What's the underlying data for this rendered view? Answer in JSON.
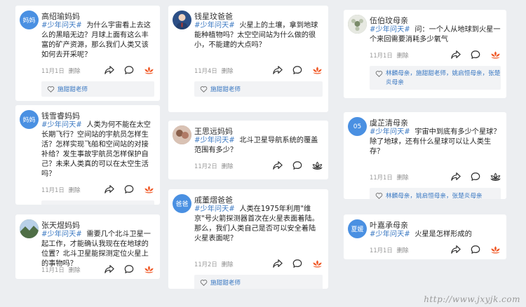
{
  "posts": [
    {
      "name": "高绍瑜妈妈",
      "avatar_text": "妈妈",
      "avatar_color": "#4a90e2",
      "tag": "#少年问天#",
      "text": "为什么宇宙看上去这么的黑暗无边？月球上面有这么丰富的矿产资源，那么我们人类又该如何去开采呢？",
      "date": "11月1日",
      "delete": "删除",
      "likes": "施甜甜老师",
      "liked": true
    },
    {
      "name": "钱雪睿妈妈",
      "avatar_text": "妈妈",
      "avatar_color": "#4a90e2",
      "tag": "#少年问天#",
      "text": "人类为何不能在太空长期飞行？空间站的宇航员怎样生活？怎样实现飞船和空间站的对接补给？发生事故宇航员怎样保护自己？未来人类真的可以在太空生活吗？",
      "date": "11月1日",
      "delete": "删除",
      "likes": "施甜甜老师",
      "liked": true
    },
    {
      "name": "张天煜妈妈",
      "avatar_text": "",
      "avatar_color": "#5c7a52",
      "tag": "#少年问天#",
      "text": "需要几个北斗卫星一起工作，才能确认我现在在地球的位置？北斗卫星能探测定位火星上的事物吗？",
      "date": "11月1日",
      "delete": "删除",
      "likes": "",
      "liked": true
    },
    {
      "name": "钱星玟爸爸",
      "avatar_text": "",
      "avatar_color": "#2c4f86",
      "tag": "#少年问天#",
      "text": "火星上的土壤，拿到地球能种植物吗？太空空间站为什么做的很小，不能建的大点吗？",
      "date": "11月4日",
      "delete": "删除",
      "likes": "施甜甜老师",
      "liked": true
    },
    {
      "name": "王思远妈妈",
      "avatar_text": "",
      "avatar_color": "#a08474",
      "tag": "#少年问天#",
      "text": "北斗卫星导航系统的覆盖范围有多少？",
      "date": "11月2日",
      "delete": "删除",
      "likes": "",
      "liked": false
    },
    {
      "name": "戚董熠爸爸",
      "avatar_text": "爸爸",
      "avatar_color": "#4a90e2",
      "tag": "#少年问天#",
      "text": "人类在1975年利用\"维京\"号火箭探测器首次在火星表面着陆。那么，我们人类自己是否可以安全着陆火星表面呢？",
      "date": "11月2日",
      "delete": "删除",
      "likes": "施甜甜老师",
      "liked": true
    },
    {
      "name": "伍伯玟母亲",
      "avatar_text": "",
      "avatar_color": "#8c9a86",
      "tag": "#少年问天#",
      "text": "问：一个人从地球到火星一个来回需要消耗多少氧气",
      "date": "11月1日",
      "delete": "删除",
      "likes": "林麟母亲，施甜甜老师，姚启恒母亲，张楚炎母亲",
      "liked": true
    },
    {
      "name": "虞芷清母亲",
      "avatar_text": "05",
      "avatar_color": "#4a90e2",
      "tag": "#少年问天#",
      "text": "宇宙中到底有多少个星球？除了地球，还有什么星球可以让人类生存？",
      "date": "11月1日",
      "delete": "删除",
      "likes": "林麟母亲，姚启恒母亲，张楚炎母亲",
      "liked": false
    },
    {
      "name": "叶嘉承母亲",
      "avatar_text": "夏媛",
      "avatar_color": "#4a90e2",
      "tag": "#少年问天#",
      "text": "火星是怎样形成的",
      "date": "11月1日",
      "delete": "删除",
      "likes": "",
      "liked": true
    }
  ],
  "colors": {
    "accent": "#3a78c2",
    "like": "#f05a28",
    "card": "#ffffff",
    "background": "#eceef1"
  },
  "icons": {
    "share": "share-arrow-icon",
    "comment": "comment-bubble-icon",
    "like": "lotus-like-icon",
    "likes_list": "heart-outline-icon"
  },
  "watermark": "http://www.jxyjk.com"
}
